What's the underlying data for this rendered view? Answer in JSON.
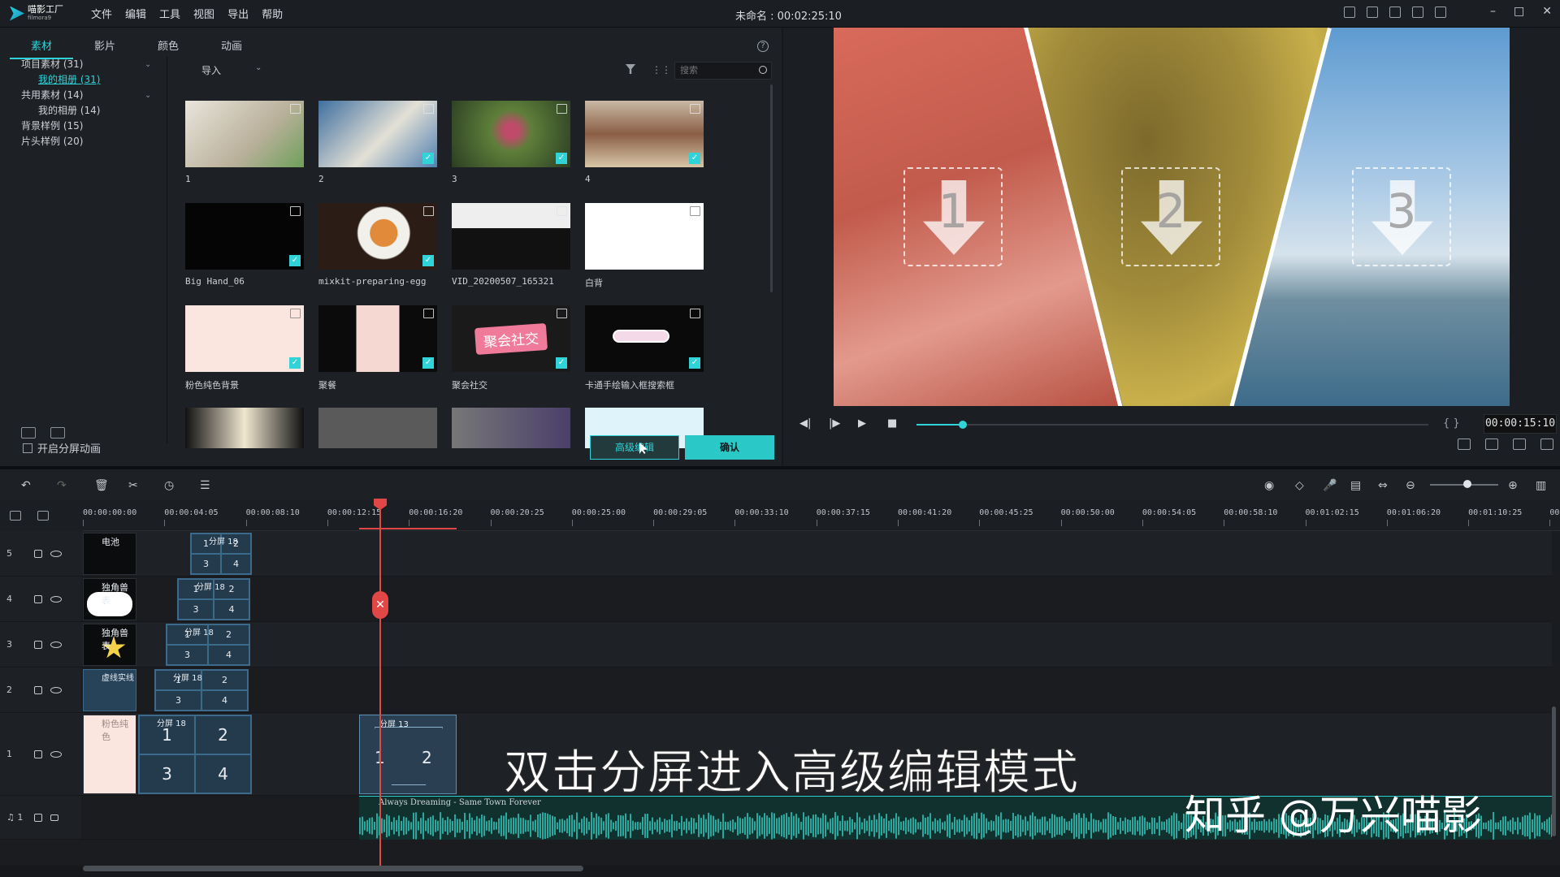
{
  "app": {
    "logo_main": "喵影工厂",
    "logo_sub": "filmora9",
    "document_title": "未命名 : 00:02:25:10",
    "menu": [
      "文件",
      "编辑",
      "工具",
      "视图",
      "导出",
      "帮助"
    ],
    "window_controls": [
      "–",
      "□",
      "✕"
    ]
  },
  "media_panel": {
    "tabs": [
      "素材",
      "影片",
      "颜色",
      "动画"
    ],
    "active_tab": "素材",
    "help": "?",
    "tree": [
      {
        "label": "项目素材 (31)",
        "level": 0,
        "expanded": true
      },
      {
        "label": "我的相册 (31)",
        "level": 1,
        "selected": true
      },
      {
        "label": "共用素材 (14)",
        "level": 0,
        "expanded": true
      },
      {
        "label": "我的相册 (14)",
        "level": 1
      },
      {
        "label": "背景样例 (15)",
        "level": 0
      },
      {
        "label": "片头样例 (20)",
        "level": 0
      }
    ],
    "import_label": "导入",
    "search_placeholder": "搜索",
    "split_animation_checkbox": "开启分屏动画",
    "advanced_edit_button": "高级编辑",
    "confirm_button": "确认",
    "items": [
      {
        "caption": "1",
        "kind": "video",
        "checked": false,
        "color": "#d9d5cc"
      },
      {
        "caption": "2",
        "kind": "video",
        "checked": true,
        "color": "#4f7fb0"
      },
      {
        "caption": "3",
        "kind": "video",
        "checked": true,
        "color": "#4a6a3a"
      },
      {
        "caption": "4",
        "kind": "video",
        "checked": true,
        "color": "#7a5a45"
      },
      {
        "caption": "Big Hand_06",
        "kind": "video",
        "checked": true,
        "color": "#050505"
      },
      {
        "caption": "mixkit-preparing-egg",
        "kind": "video",
        "checked": true,
        "color": "#3a2a20"
      },
      {
        "caption": "VID_20200507_165321",
        "kind": "video",
        "checked": false,
        "color": "#101010"
      },
      {
        "caption": "白背",
        "kind": "image",
        "checked": false,
        "color": "#ffffff"
      },
      {
        "caption": "粉色纯色背景",
        "kind": "image",
        "checked": true,
        "color": "#fbe5df"
      },
      {
        "caption": "聚餐",
        "kind": "image",
        "checked": true,
        "color": "#0b0b0b"
      },
      {
        "caption": "聚会社交",
        "kind": "image",
        "checked": true,
        "color": "#1a1a1a"
      },
      {
        "caption": "卡通手绘输入框搜索框",
        "kind": "image",
        "checked": true,
        "color": "#0a0a0a"
      }
    ],
    "thumb_texts": {
      "party": "聚会社交"
    }
  },
  "preview": {
    "zones": [
      "1",
      "2",
      "3"
    ],
    "timecode": "00:00:15:10",
    "progress": 0.09,
    "brackets": "{  }",
    "controls": [
      "◀|",
      "|▶",
      "▶",
      "■"
    ]
  },
  "timeline": {
    "ruler": [
      "00:00:00:00",
      "00:00:04:05",
      "00:00:08:10",
      "00:00:12:15",
      "00:00:16:20",
      "00:00:20:25",
      "00:00:25:00",
      "00:00:29:05",
      "00:00:33:10",
      "00:00:37:15",
      "00:00:41:20",
      "00:00:45:25",
      "00:00:50:00",
      "00:00:54:05",
      "00:00:58:10",
      "00:01:02:15",
      "00:01:06:20",
      "00:01:10:25",
      "00"
    ],
    "tracks": [
      {
        "label": "5",
        "media_name": "电池",
        "split_name": "分屏 18"
      },
      {
        "label": "4",
        "media_name": "独角兽表",
        "split_name": "分屏 18"
      },
      {
        "label": "3",
        "media_name": "独角兽表",
        "split_name": "分屏 18"
      },
      {
        "label": "2",
        "media_name": "虚线实线",
        "split_name": "分屏 18"
      },
      {
        "label": "1",
        "media_name": "粉色纯色",
        "split_name": "分屏 18",
        "split13_name": "分屏 13"
      }
    ],
    "audio_track": {
      "label": "1",
      "clip_name": "Always Dreaming - Same Town Forever"
    },
    "cells": [
      "1",
      "2",
      "3",
      "4"
    ],
    "split13_cells": [
      "1",
      "2"
    ],
    "zoom": 0.55
  },
  "overlay": {
    "caption": "双击分屏进入高级编辑模式",
    "watermark": "知乎 @万兴喵影"
  }
}
